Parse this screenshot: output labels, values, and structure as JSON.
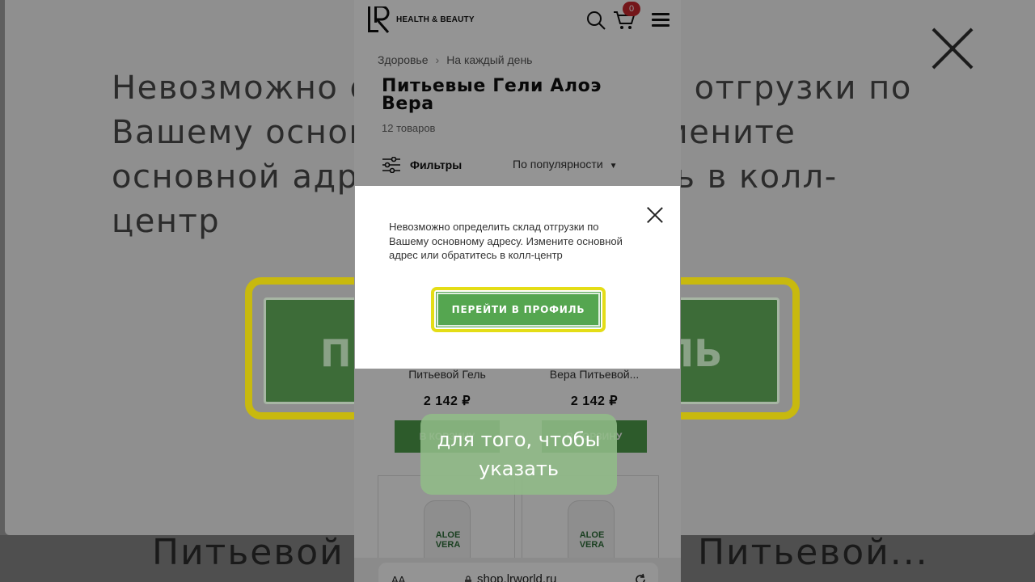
{
  "background": {
    "message": "Невозможно определить склад отгрузки по Вашему основному адресу. Измените основной адрес или обратитесь в колл-центр",
    "button_left": "ПЕ",
    "button_right": "ЛЬ",
    "bottom_left": "Питьевой",
    "bottom_right": "а Питьевой..."
  },
  "header": {
    "logo_text": "HEALTH & BEAUTY",
    "cart_count": "0"
  },
  "breadcrumb": {
    "items": [
      "Здоровье",
      "На каждый день"
    ],
    "separator": "›"
  },
  "page": {
    "title": "Питьевые Гели Алоэ Вера",
    "count": "12 товаров",
    "filters_label": "Фильтры",
    "sort_label": "По популярности"
  },
  "products": [
    {
      "name": "Питьевой Гель",
      "price": "2 142 ₽",
      "button": "В КОРЗИНУ"
    },
    {
      "name": "Вера Питьевой...",
      "price": "2 142 ₽",
      "button": "В КОРЗИНУ"
    }
  ],
  "product_cards": [
    {
      "label": "ALOE VERA"
    },
    {
      "label": "ALOE VERA"
    }
  ],
  "browser": {
    "aa": "AA",
    "url": "shop.lrworld.ru"
  },
  "modal": {
    "message": "Невозможно определить склад отгрузки по Вашему основному адресу. Измените основной адрес или обратитесь в колл-центр",
    "button_label": "ПЕРЕЙТИ В ПРОФИЛЬ"
  },
  "caption": {
    "text": "для того, чтобы указать"
  },
  "colors": {
    "accent_green": "#55a650",
    "highlight_yellow": "#e4dd16",
    "badge_red": "#c8262d"
  }
}
